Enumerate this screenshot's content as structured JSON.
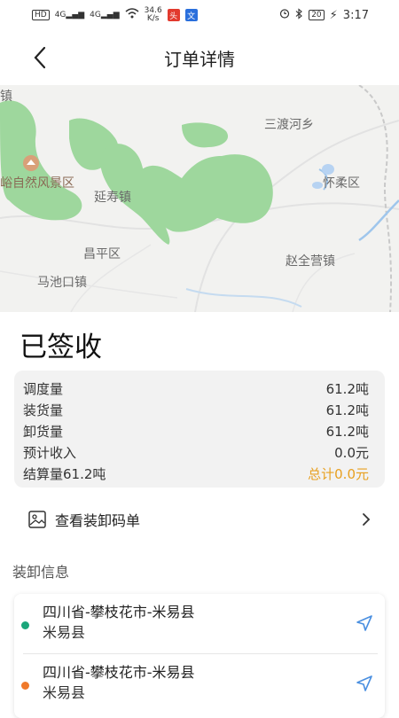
{
  "status_bar": {
    "left_badge": "HD",
    "net1": "4G",
    "net2": "4G",
    "speed_value": "34.6",
    "speed_unit": "K/s",
    "app_icon1": "news-app-icon",
    "app_icon2": "translate-app-icon",
    "app_icon2_text": "文",
    "battery": "20",
    "time": "3:17"
  },
  "nav": {
    "title": "订单详情"
  },
  "map": {
    "labels": [
      "镇",
      "三渡河乡",
      "峪自然风景区",
      "怀柔区",
      "延寿镇",
      "昌平区",
      "赵全营镇",
      "马池口镇"
    ]
  },
  "order": {
    "status": "已签收"
  },
  "stats": {
    "rows": [
      {
        "label": "调度量",
        "value": "61.2吨"
      },
      {
        "label": "装货量",
        "value": "61.2吨"
      },
      {
        "label": "卸货量",
        "value": "61.2吨"
      },
      {
        "label": "预计收入",
        "value": "0.0元"
      },
      {
        "label": "结算量61.2吨",
        "value": "总计0.0元"
      }
    ],
    "total_color": "#e8a020"
  },
  "manifest": {
    "label": "查看装卸码单"
  },
  "section": {
    "title": "装卸信息"
  },
  "addresses": [
    {
      "line1": "四川省-攀枝花市-米易县",
      "line2": "米易县",
      "dot_color": "#1aa67a"
    },
    {
      "line1": "四川省-攀枝花市-米易县",
      "line2": "米易县",
      "dot_color": "#f0792a"
    }
  ]
}
